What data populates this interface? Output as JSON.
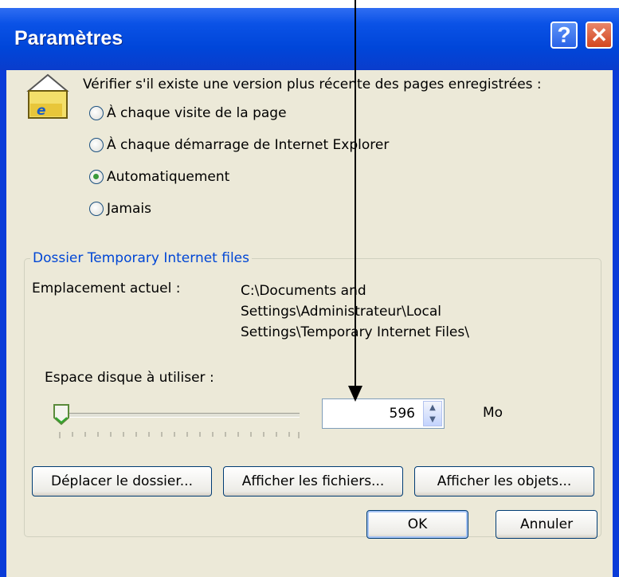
{
  "titlebar": {
    "title": "Paramètres",
    "help_label": "?",
    "close_label": "✕"
  },
  "check_section": {
    "label": "Vérifier s'il existe une version plus récente des pages enregistrées :",
    "options": [
      {
        "label": "À chaque visite de la page",
        "checked": false
      },
      {
        "label": "À chaque démarrage de Internet Explorer",
        "checked": false
      },
      {
        "label": "Automatiquement",
        "checked": true
      },
      {
        "label": "Jamais",
        "checked": false
      }
    ]
  },
  "temp_folder": {
    "legend": "Dossier Temporary Internet files",
    "location_label": "Emplacement actuel :",
    "location_lines": [
      "C:\\Documents and",
      "Settings\\Administrateur\\Local",
      "Settings\\Temporary Internet Files\\"
    ],
    "disk_label": "Espace disque à utiliser :",
    "disk_value": "596",
    "unit": "Mo"
  },
  "buttons": {
    "move_folder": "Déplacer le dossier...",
    "view_files": "Afficher les fichiers...",
    "view_objects": "Afficher les objets...",
    "ok": "OK",
    "cancel": "Annuler"
  },
  "colors": {
    "title_bar": "#0a52e6",
    "dialog_bg": "#ece9d8",
    "group_legend": "#0046d5"
  }
}
